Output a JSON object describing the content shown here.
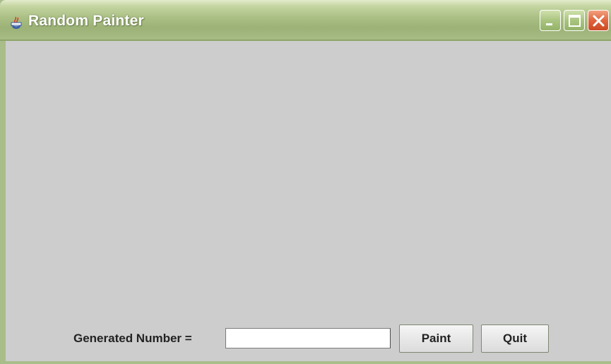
{
  "window": {
    "title": "Random Painter",
    "controls": {
      "minimize": "minimize-icon",
      "maximize": "maximize-icon",
      "close": "close-icon"
    }
  },
  "footer": {
    "label": "Generated Number =",
    "number_value": "",
    "paint_label": "Paint",
    "quit_label": "Quit"
  },
  "colors": {
    "canvas_background": "#cdcdcd",
    "titlebar": "#aabf84",
    "close_button": "#e0653e"
  }
}
